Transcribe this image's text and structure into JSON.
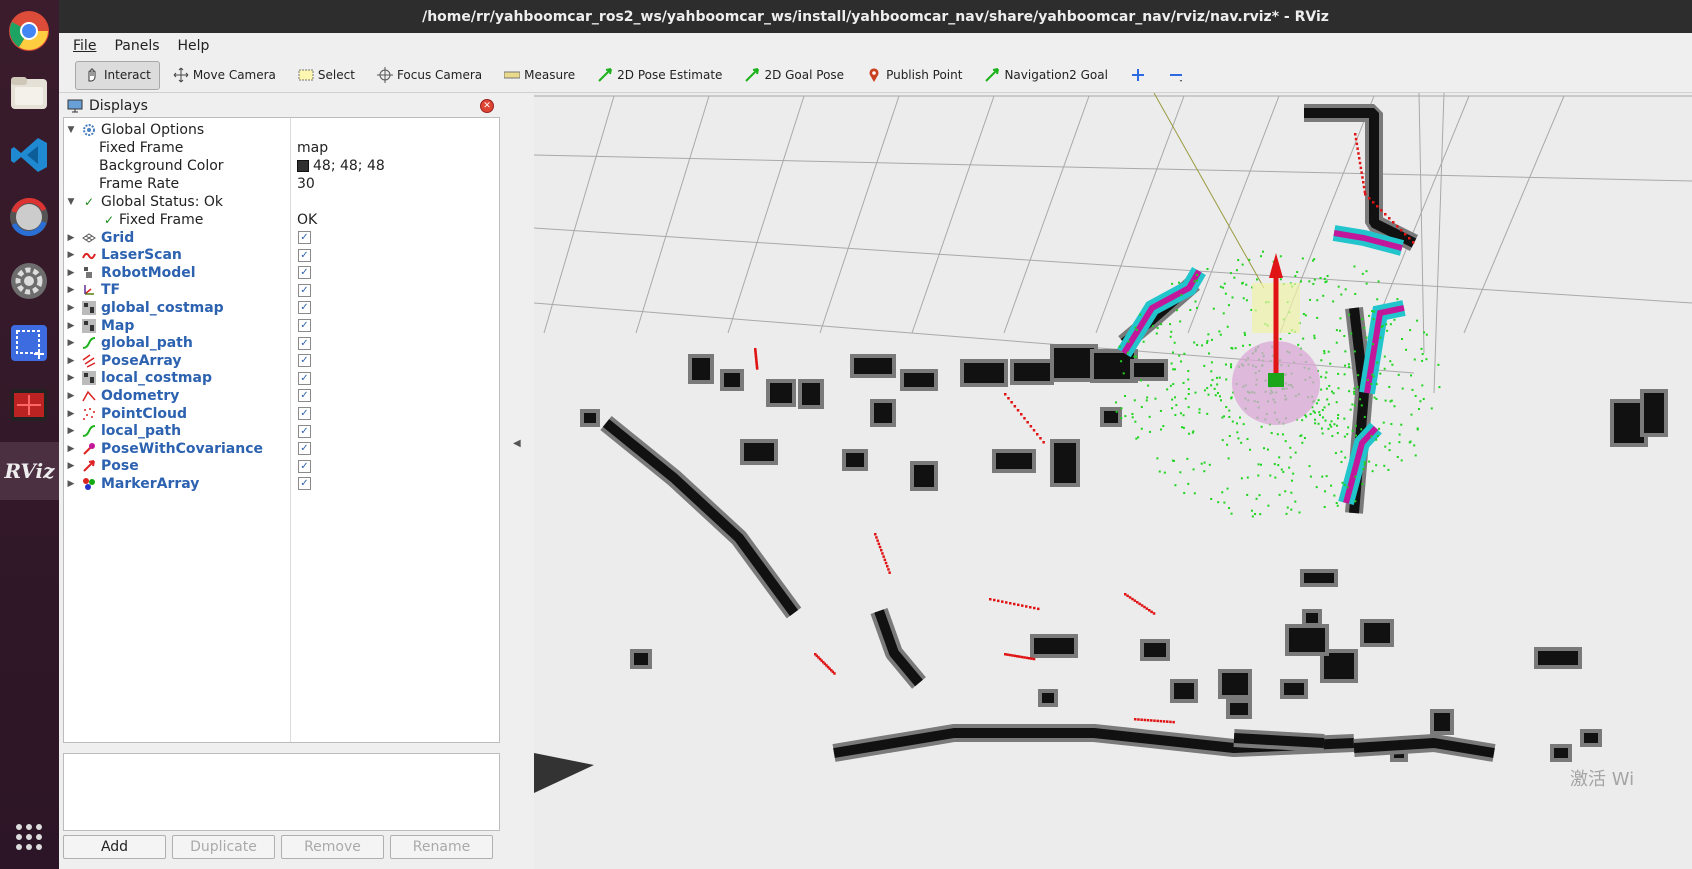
{
  "window": {
    "title": "/home/rr/yahboomcar_ros2_ws/yahboomcar_ws/install/yahboomcar_nav/share/yahboomcar_nav/rviz/nav.rviz* - RViz"
  },
  "menu": {
    "file": "File",
    "panels": "Panels",
    "help": "Help"
  },
  "toolbar": {
    "interact": "Interact",
    "move_camera": "Move Camera",
    "select": "Select",
    "focus_camera": "Focus Camera",
    "measure": "Measure",
    "pose_estimate": "2D Pose Estimate",
    "goal_pose": "2D Goal Pose",
    "publish_point": "Publish Point",
    "nav2_goal": "Navigation2 Goal"
  },
  "displays": {
    "title": "Displays",
    "global_options": {
      "label": "Global Options",
      "fixed_frame_label": "Fixed Frame",
      "fixed_frame_value": "map",
      "bg_label": "Background Color",
      "bg_value": "48; 48; 48",
      "bg_color": "#303030",
      "frame_rate_label": "Frame Rate",
      "frame_rate_value": "30"
    },
    "global_status": {
      "label": "Global Status: Ok",
      "fixed_frame_label": "Fixed Frame",
      "fixed_frame_value": "OK"
    },
    "items": [
      {
        "label": "Grid",
        "icon": "grid-icon"
      },
      {
        "label": "LaserScan",
        "icon": "laserscan-icon"
      },
      {
        "label": "RobotModel",
        "icon": "robot-icon"
      },
      {
        "label": "TF",
        "icon": "tf-icon"
      },
      {
        "label": "global_costmap",
        "icon": "map-icon"
      },
      {
        "label": "Map",
        "icon": "map-icon"
      },
      {
        "label": "global_path",
        "icon": "path-icon"
      },
      {
        "label": "PoseArray",
        "icon": "posearray-icon"
      },
      {
        "label": "local_costmap",
        "icon": "map-icon"
      },
      {
        "label": "Odometry",
        "icon": "odometry-icon"
      },
      {
        "label": "PointCloud",
        "icon": "pointcloud-icon"
      },
      {
        "label": "local_path",
        "icon": "path-icon"
      },
      {
        "label": "PoseWithCovariance",
        "icon": "pose-covariance-icon"
      },
      {
        "label": "Pose",
        "icon": "pose-icon"
      },
      {
        "label": "MarkerArray",
        "icon": "markerarray-icon"
      }
    ]
  },
  "buttons": {
    "add": "Add",
    "duplicate": "Duplicate",
    "remove": "Remove",
    "rename": "Rename"
  },
  "watermark": "激活 Wi",
  "colors": {
    "link_blue": "#2c62b0",
    "costmap_cyan": "#22c5cc",
    "costmap_magenta": "#c2179a",
    "laser_red": "#e01414",
    "pointcloud_green": "#1ed41e"
  }
}
